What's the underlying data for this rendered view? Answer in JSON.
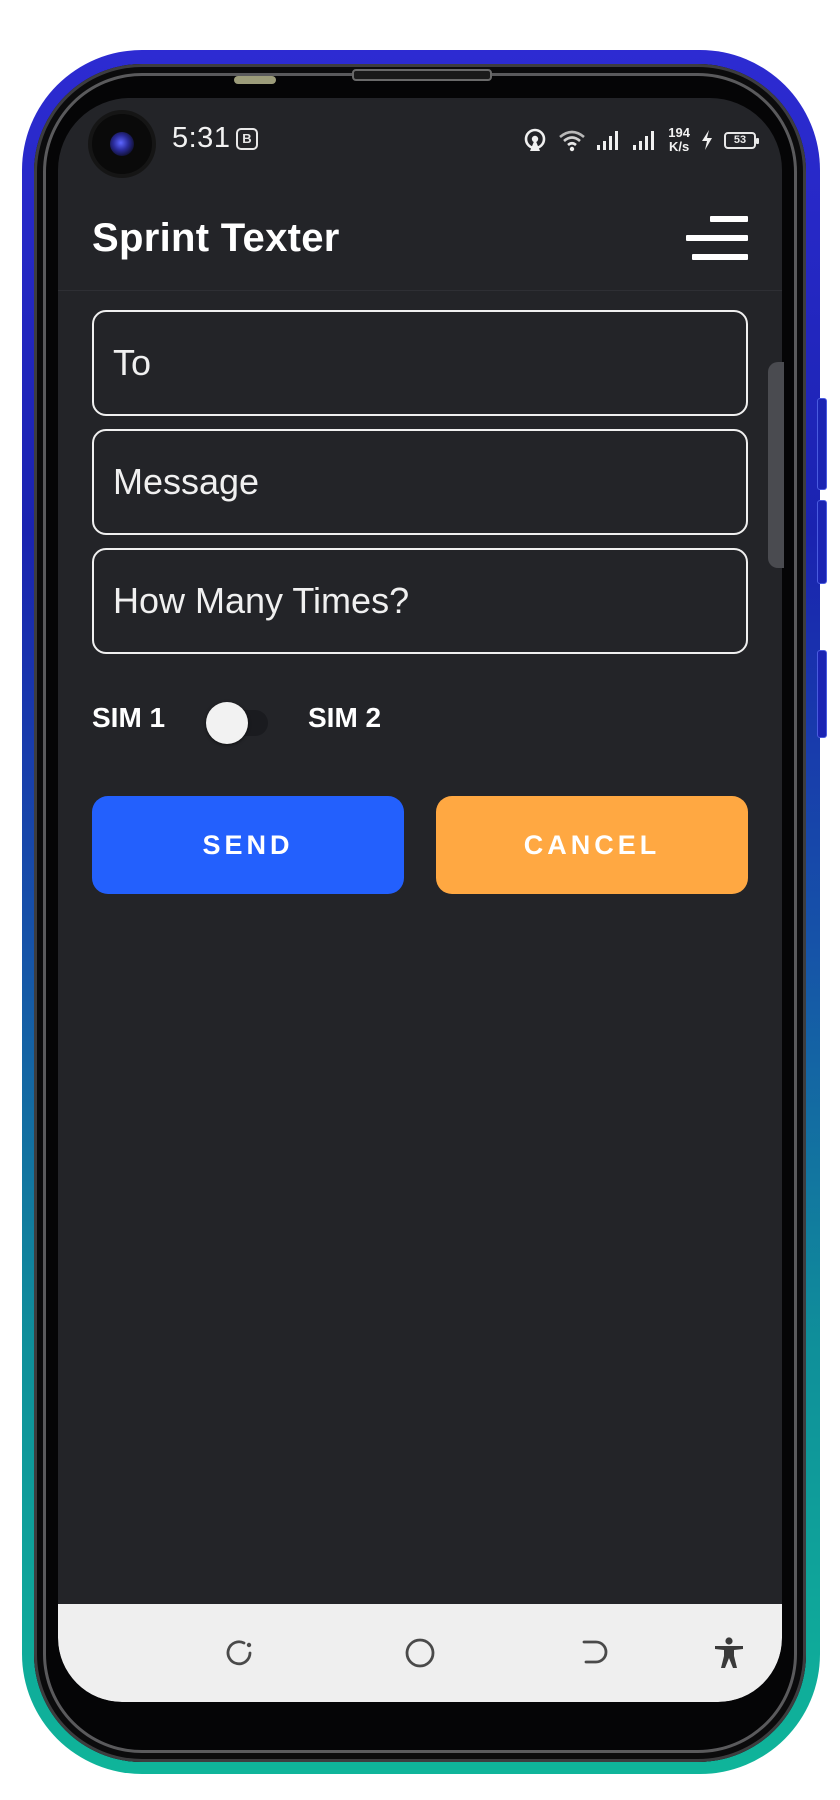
{
  "status_bar": {
    "time": "5:31",
    "app_icon_glyph": "B",
    "net_speed_value": "194",
    "net_speed_unit": "K/s",
    "battery_level": "53",
    "icons": [
      "hotspot-icon",
      "wifi-icon",
      "signal-sim1-icon",
      "signal-sim2-icon",
      "charging-icon",
      "battery-icon"
    ]
  },
  "app_bar": {
    "title": "Sprint Texter",
    "menu_icon": "menu-icon"
  },
  "form": {
    "to_placeholder": "To",
    "to_value": "",
    "message_placeholder": "Message",
    "message_value": "",
    "times_placeholder": "How Many Times?",
    "times_value": ""
  },
  "sim_toggle": {
    "left_label": "SIM 1",
    "right_label": "SIM 2",
    "selected": "SIM 1"
  },
  "actions": {
    "send_label": "SEND",
    "cancel_label": "CANCEL"
  },
  "nav_bar": {
    "icons": [
      "recents-icon",
      "home-icon",
      "back-icon",
      "accessibility-icon"
    ]
  },
  "colors": {
    "screen_background": "#232428",
    "send_button": "#2360fd",
    "cancel_button": "#ffa842",
    "nav_bar_background": "#efefef"
  }
}
